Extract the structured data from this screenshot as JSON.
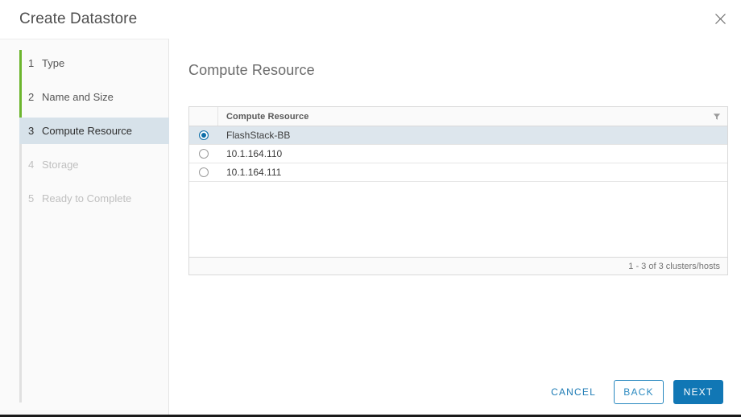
{
  "window": {
    "title": "Create Datastore",
    "close_icon": "close-icon"
  },
  "sidebar": {
    "steps": [
      {
        "num": "1",
        "label": "Type",
        "state": "done"
      },
      {
        "num": "2",
        "label": "Name and Size",
        "state": "done"
      },
      {
        "num": "3",
        "label": "Compute Resource",
        "state": "active"
      },
      {
        "num": "4",
        "label": "Storage",
        "state": "disabled"
      },
      {
        "num": "5",
        "label": "Ready to Complete",
        "state": "disabled"
      }
    ],
    "rail_done_color": "#6cb52d",
    "active_bg": "#d7e2ea"
  },
  "main": {
    "heading": "Compute Resource",
    "table": {
      "radio_column_header": "",
      "columns": [
        "Compute Resource"
      ],
      "filter_icon": "filter-funnel-icon",
      "rows": [
        {
          "label": "FlashStack-BB",
          "selected": true
        },
        {
          "label": "10.1.164.110",
          "selected": false
        },
        {
          "label": "10.1.164.111",
          "selected": false
        }
      ],
      "footer_count": "1 - 3 of 3 clusters/hosts"
    }
  },
  "footer": {
    "cancel_label": "CANCEL",
    "back_label": "BACK",
    "next_label": "NEXT",
    "next_bg": "#1177b5",
    "back_border": "#2a89c0",
    "link_color": "#1d7bb5"
  }
}
